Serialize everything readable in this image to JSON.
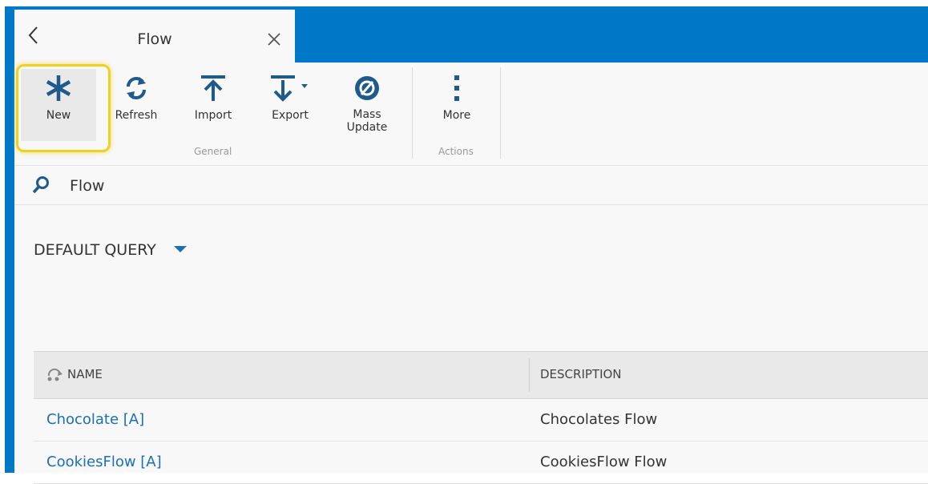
{
  "tab": {
    "title": "Flow"
  },
  "ribbon": {
    "buttons": [
      {
        "label": "New"
      },
      {
        "label": "Refresh"
      },
      {
        "label": "Import"
      },
      {
        "label": "Export"
      },
      {
        "label": "Mass\nUpdate"
      },
      {
        "label": "More"
      }
    ],
    "groups": [
      {
        "label": "General"
      },
      {
        "label": "Actions"
      }
    ]
  },
  "search": {
    "text": "Flow"
  },
  "query": {
    "label": "DEFAULT QUERY"
  },
  "grid": {
    "columns": [
      {
        "label": "NAME"
      },
      {
        "label": "DESCRIPTION"
      }
    ],
    "rows": [
      {
        "name": "Chocolate [A]",
        "description": "Chocolates Flow"
      },
      {
        "name": "CookiesFlow [A]",
        "description": "CookiesFlow Flow"
      }
    ]
  },
  "colors": {
    "accent": "#0078c8",
    "link": "#1a6fb5",
    "highlight": "#f2d11c",
    "icon": "#1f5a8c"
  }
}
